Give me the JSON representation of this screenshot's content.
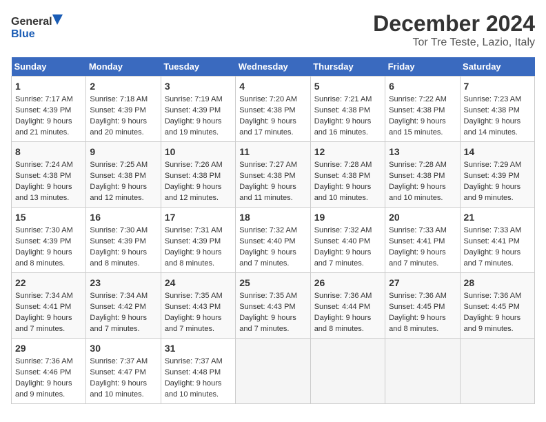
{
  "header": {
    "logo_general": "General",
    "logo_blue": "Blue",
    "title": "December 2024",
    "location": "Tor Tre Teste, Lazio, Italy"
  },
  "days_of_week": [
    "Sunday",
    "Monday",
    "Tuesday",
    "Wednesday",
    "Thursday",
    "Friday",
    "Saturday"
  ],
  "weeks": [
    [
      {
        "day": 1,
        "sunrise": "7:17 AM",
        "sunset": "4:39 PM",
        "daylight": "9 hours and 21 minutes."
      },
      {
        "day": 2,
        "sunrise": "7:18 AM",
        "sunset": "4:39 PM",
        "daylight": "9 hours and 20 minutes."
      },
      {
        "day": 3,
        "sunrise": "7:19 AM",
        "sunset": "4:39 PM",
        "daylight": "9 hours and 19 minutes."
      },
      {
        "day": 4,
        "sunrise": "7:20 AM",
        "sunset": "4:38 PM",
        "daylight": "9 hours and 17 minutes."
      },
      {
        "day": 5,
        "sunrise": "7:21 AM",
        "sunset": "4:38 PM",
        "daylight": "9 hours and 16 minutes."
      },
      {
        "day": 6,
        "sunrise": "7:22 AM",
        "sunset": "4:38 PM",
        "daylight": "9 hours and 15 minutes."
      },
      {
        "day": 7,
        "sunrise": "7:23 AM",
        "sunset": "4:38 PM",
        "daylight": "9 hours and 14 minutes."
      }
    ],
    [
      {
        "day": 8,
        "sunrise": "7:24 AM",
        "sunset": "4:38 PM",
        "daylight": "9 hours and 13 minutes."
      },
      {
        "day": 9,
        "sunrise": "7:25 AM",
        "sunset": "4:38 PM",
        "daylight": "9 hours and 12 minutes."
      },
      {
        "day": 10,
        "sunrise": "7:26 AM",
        "sunset": "4:38 PM",
        "daylight": "9 hours and 12 minutes."
      },
      {
        "day": 11,
        "sunrise": "7:27 AM",
        "sunset": "4:38 PM",
        "daylight": "9 hours and 11 minutes."
      },
      {
        "day": 12,
        "sunrise": "7:28 AM",
        "sunset": "4:38 PM",
        "daylight": "9 hours and 10 minutes."
      },
      {
        "day": 13,
        "sunrise": "7:28 AM",
        "sunset": "4:38 PM",
        "daylight": "9 hours and 10 minutes."
      },
      {
        "day": 14,
        "sunrise": "7:29 AM",
        "sunset": "4:39 PM",
        "daylight": "9 hours and 9 minutes."
      }
    ],
    [
      {
        "day": 15,
        "sunrise": "7:30 AM",
        "sunset": "4:39 PM",
        "daylight": "9 hours and 8 minutes."
      },
      {
        "day": 16,
        "sunrise": "7:30 AM",
        "sunset": "4:39 PM",
        "daylight": "9 hours and 8 minutes."
      },
      {
        "day": 17,
        "sunrise": "7:31 AM",
        "sunset": "4:39 PM",
        "daylight": "9 hours and 8 minutes."
      },
      {
        "day": 18,
        "sunrise": "7:32 AM",
        "sunset": "4:40 PM",
        "daylight": "9 hours and 7 minutes."
      },
      {
        "day": 19,
        "sunrise": "7:32 AM",
        "sunset": "4:40 PM",
        "daylight": "9 hours and 7 minutes."
      },
      {
        "day": 20,
        "sunrise": "7:33 AM",
        "sunset": "4:41 PM",
        "daylight": "9 hours and 7 minutes."
      },
      {
        "day": 21,
        "sunrise": "7:33 AM",
        "sunset": "4:41 PM",
        "daylight": "9 hours and 7 minutes."
      }
    ],
    [
      {
        "day": 22,
        "sunrise": "7:34 AM",
        "sunset": "4:41 PM",
        "daylight": "9 hours and 7 minutes."
      },
      {
        "day": 23,
        "sunrise": "7:34 AM",
        "sunset": "4:42 PM",
        "daylight": "9 hours and 7 minutes."
      },
      {
        "day": 24,
        "sunrise": "7:35 AM",
        "sunset": "4:43 PM",
        "daylight": "9 hours and 7 minutes."
      },
      {
        "day": 25,
        "sunrise": "7:35 AM",
        "sunset": "4:43 PM",
        "daylight": "9 hours and 7 minutes."
      },
      {
        "day": 26,
        "sunrise": "7:36 AM",
        "sunset": "4:44 PM",
        "daylight": "9 hours and 8 minutes."
      },
      {
        "day": 27,
        "sunrise": "7:36 AM",
        "sunset": "4:45 PM",
        "daylight": "9 hours and 8 minutes."
      },
      {
        "day": 28,
        "sunrise": "7:36 AM",
        "sunset": "4:45 PM",
        "daylight": "9 hours and 9 minutes."
      }
    ],
    [
      {
        "day": 29,
        "sunrise": "7:36 AM",
        "sunset": "4:46 PM",
        "daylight": "9 hours and 9 minutes."
      },
      {
        "day": 30,
        "sunrise": "7:37 AM",
        "sunset": "4:47 PM",
        "daylight": "9 hours and 10 minutes."
      },
      {
        "day": 31,
        "sunrise": "7:37 AM",
        "sunset": "4:48 PM",
        "daylight": "9 hours and 10 minutes."
      },
      null,
      null,
      null,
      null
    ]
  ]
}
